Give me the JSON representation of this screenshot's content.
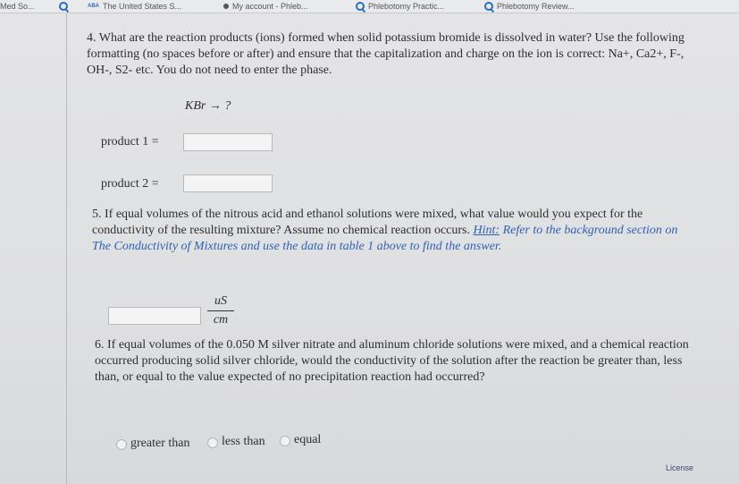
{
  "browser": {
    "tabs": [
      {
        "label": "Med So...",
        "icon": "none"
      },
      {
        "label": "",
        "icon": "search-icon"
      },
      {
        "label": "The United States S...",
        "icon": "aba-icon"
      },
      {
        "label": "My account - Phleb...",
        "icon": "dot-icon"
      },
      {
        "label": "Phlebotomy Practic...",
        "icon": "search-icon"
      },
      {
        "label": "Phlebotomy Review...",
        "icon": "search-icon"
      }
    ]
  },
  "q4": {
    "text": "4. What are the reaction products (ions) formed when solid potassium bromide is dissolved in water? Use the following formatting (no spaces before or after) and ensure that the capitalization and charge on the ion is correct: Na+, Ca2+, F-, OH-, S2- etc. You do not need to enter the phase.",
    "equation": "KBr → ?",
    "product1_label": "product 1 =",
    "product2_label": "product 2 =",
    "product1_value": "",
    "product2_value": ""
  },
  "q5": {
    "text": "5. If equal volumes of the nitrous acid and ethanol solutions were mixed, what value would you expect for the conductivity of the resulting mixture? Assume no chemical reaction occurs.",
    "hint_label": "Hint:",
    "hint_text": "Refer to the background section on The Conductivity of Mixtures and use the data in table 1 above to find the answer.",
    "answer_value": "",
    "unit_numerator": "uS",
    "unit_denominator": "cm"
  },
  "q6": {
    "text": "6. If equal volumes of the 0.050 M silver nitrate and aluminum chloride solutions were mixed, and a chemical reaction occurred producing solid silver chloride, would the conductivity of the solution after the reaction be greater than, less than, or equal to the value expected of no precipitation reaction had occurred?",
    "options": [
      "greater than",
      "less than",
      "equal"
    ]
  },
  "footer": {
    "license": "License"
  }
}
